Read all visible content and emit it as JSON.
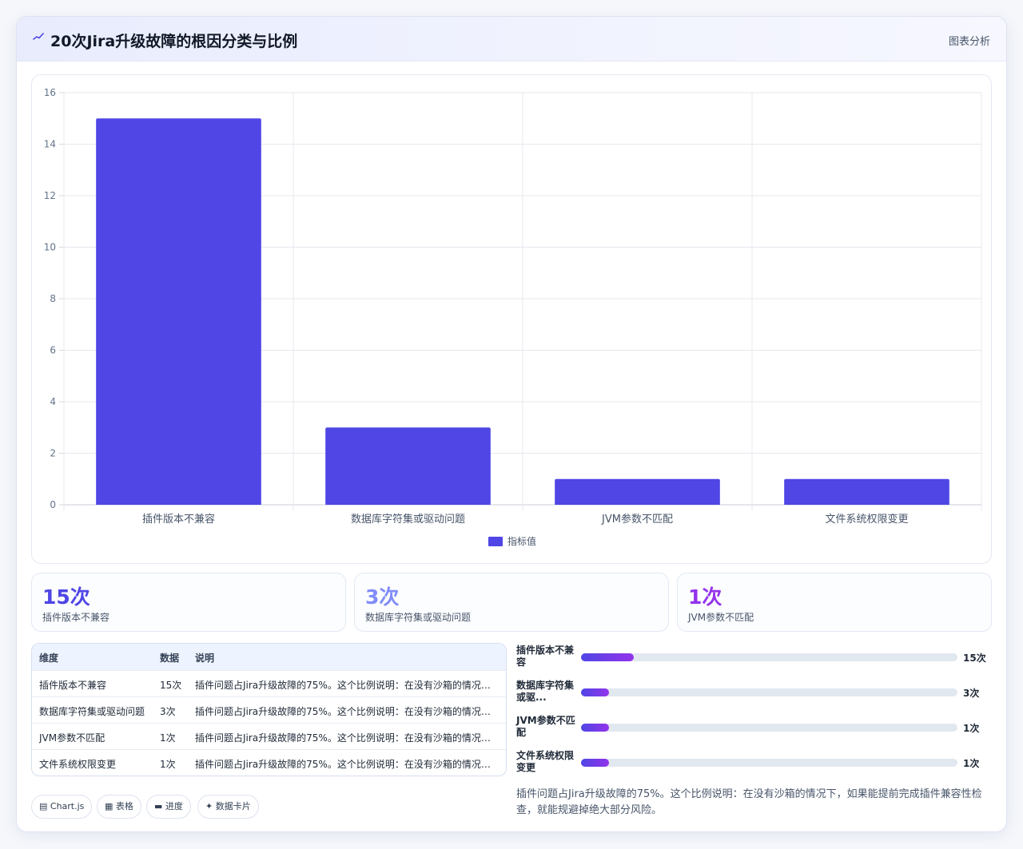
{
  "header": {
    "title": "20次Jira升级故障的根因分类与比例",
    "tag": "图表分析"
  },
  "chart_data": {
    "type": "bar",
    "categories": [
      "插件版本不兼容",
      "数据库字符集或驱动问题",
      "JVM参数不匹配",
      "文件系统权限变更"
    ],
    "series": [
      {
        "name": "指标值",
        "values": [
          15,
          3,
          1,
          1
        ]
      }
    ],
    "ylim": [
      0,
      16
    ],
    "yticks": [
      0,
      2,
      4,
      6,
      8,
      10,
      12,
      14,
      16
    ],
    "grid": true,
    "legend": "bottom",
    "bar_color": "#4f46e5"
  },
  "stats": [
    {
      "value": "15次",
      "label": "插件版本不兼容",
      "color": "#4f46e5"
    },
    {
      "value": "3次",
      "label": "数据库字符集或驱动问题",
      "color": "#818cf8"
    },
    {
      "value": "1次",
      "label": "JVM参数不匹配",
      "color": "#9333ea"
    }
  ],
  "table": {
    "headers": [
      "维度",
      "数据",
      "说明"
    ],
    "rows": [
      [
        "插件版本不兼容",
        "15次",
        "插件问题占Jira升级故障的75%。这个比例说明：在没有沙箱的情况下..."
      ],
      [
        "数据库字符集或驱动问题",
        "3次",
        "插件问题占Jira升级故障的75%。这个比例说明：在没有沙箱的情况下..."
      ],
      [
        "JVM参数不匹配",
        "1次",
        "插件问题占Jira升级故障的75%。这个比例说明：在没有沙箱的情况下..."
      ],
      [
        "文件系统权限变更",
        "1次",
        "插件问题占Jira升级故障的75%。这个比例说明：在没有沙箱的情况下..."
      ]
    ]
  },
  "chips": [
    "▤ Chart.js",
    "▦ 表格",
    "▬ 进度",
    "✦ 数据卡片"
  ],
  "progress": [
    {
      "label": "插件版本不兼容",
      "value_text": "15次",
      "fraction": 0.14
    },
    {
      "label": "数据库字符集或驱...",
      "value_text": "3次",
      "fraction": 0.075
    },
    {
      "label": "JVM参数不匹配",
      "value_text": "1次",
      "fraction": 0.075
    },
    {
      "label": "文件系统权限变更",
      "value_text": "1次",
      "fraction": 0.075
    }
  ],
  "note": "插件问题占Jira升级故障的75%。这个比例说明：在没有沙箱的情况下，如果能提前完成插件兼容性检查，就能规避掉绝大部分风险。"
}
